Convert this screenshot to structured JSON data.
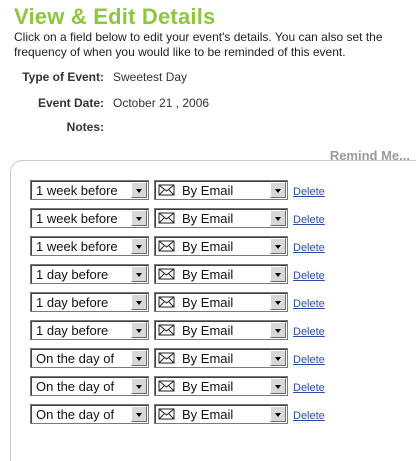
{
  "header": {
    "title": "View & Edit Details",
    "intro": "Click on a field below to edit your event's details. You can also set the frequency of when you would like to be reminded of this event."
  },
  "details": {
    "type_label": "Type of Event:",
    "type_value": "Sweetest Day",
    "date_label": "Event Date:",
    "date_value": "October 21 , 2006",
    "notes_label": "Notes:",
    "notes_value": ""
  },
  "reminders": {
    "title": "Remind Me...",
    "method_icon": "envelope-icon",
    "rows": [
      {
        "timing": "1 week before",
        "method": "By Email",
        "delete": "Delete"
      },
      {
        "timing": "1 week before",
        "method": "By Email",
        "delete": "Delete"
      },
      {
        "timing": "1 week before",
        "method": "By Email",
        "delete": "Delete"
      },
      {
        "timing": "1 day before",
        "method": "By Email",
        "delete": "Delete"
      },
      {
        "timing": "1 day before",
        "method": "By Email",
        "delete": "Delete"
      },
      {
        "timing": "1 day before",
        "method": "By Email",
        "delete": "Delete"
      },
      {
        "timing": "On the day of",
        "method": "By Email",
        "delete": "Delete"
      },
      {
        "timing": "On the day of",
        "method": "By Email",
        "delete": "Delete"
      },
      {
        "timing": "On the day of",
        "method": "By Email",
        "delete": "Delete"
      }
    ]
  },
  "colors": {
    "title_green": "#8fc63f",
    "link_blue": "#2a4ea6",
    "section_gray": "#9a9a9a"
  }
}
